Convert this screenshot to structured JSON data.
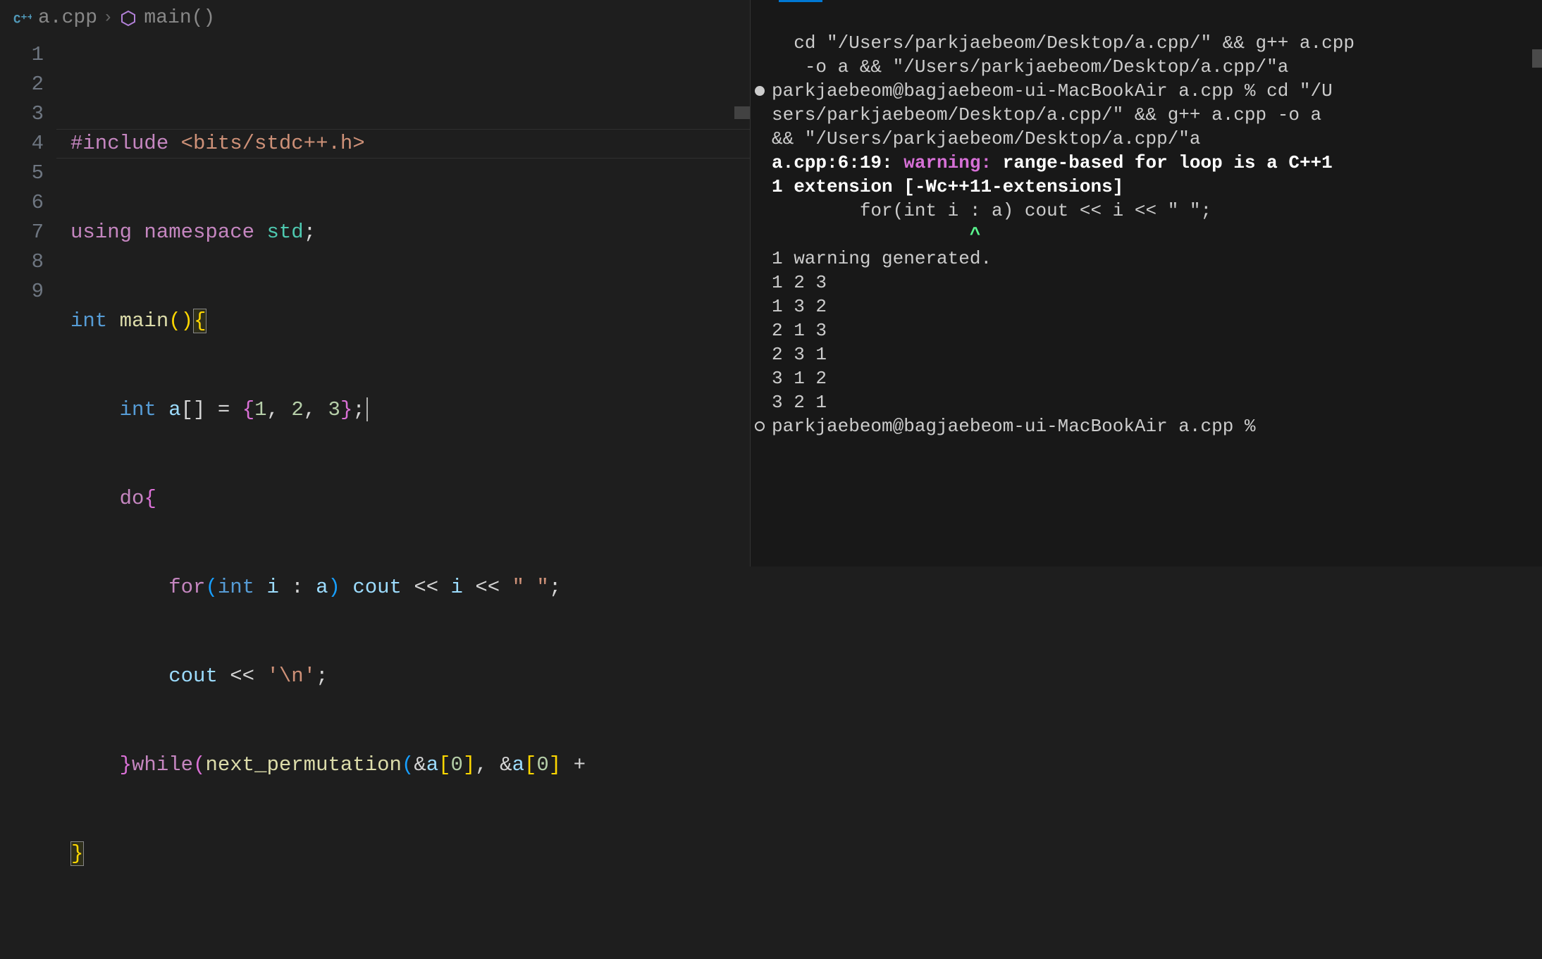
{
  "breadcrumb": {
    "file": "a.cpp",
    "symbol": "main()"
  },
  "editor": {
    "lines": [
      {
        "num": "1"
      },
      {
        "num": "2"
      },
      {
        "num": "3"
      },
      {
        "num": "4"
      },
      {
        "num": "5"
      },
      {
        "num": "6"
      },
      {
        "num": "7"
      },
      {
        "num": "8"
      },
      {
        "num": "9"
      }
    ],
    "code": {
      "l1_include": "#include",
      "l1_header": "<bits/stdc++.h>",
      "l2_using": "using",
      "l2_namespace": "namespace",
      "l2_std": "std",
      "l2_semi": ";",
      "l3_int": "int",
      "l3_main": "main",
      "l3_paren": "()",
      "l3_brace": "{",
      "l4_int": "int",
      "l4_a": "a",
      "l4_brackets": "[]",
      "l4_eq": " = ",
      "l4_braceo": "{",
      "l4_n1": "1",
      "l4_c1": ", ",
      "l4_n2": "2",
      "l4_c2": ", ",
      "l4_n3": "3",
      "l4_bracec": "}",
      "l4_semi": ";",
      "l5_do": "do",
      "l5_brace": "{",
      "l6_for": "for",
      "l6_po": "(",
      "l6_int": "int",
      "l6_i": "i",
      "l6_colon": " : ",
      "l6_a": "a",
      "l6_pc": ")",
      "l6_cout": " cout ",
      "l6_lt1": "<<",
      "l6_i2": " i ",
      "l6_lt2": "<<",
      "l6_str": " \" \"",
      "l6_semi": ";",
      "l7_cout": "cout ",
      "l7_lt": "<<",
      "l7_nl": " '\\n'",
      "l7_semi": ";",
      "l8_bracec": "}",
      "l8_while": "while",
      "l8_po": "(",
      "l8_np": "next_permutation",
      "l8_po2": "(",
      "l8_amp1": "&",
      "l8_a1": "a",
      "l8_bo1": "[",
      "l8_n0a": "0",
      "l8_bc1": "]",
      "l8_comma": ", ",
      "l8_amp2": "&",
      "l8_a2": "a",
      "l8_bo2": "[",
      "l8_n0b": "0",
      "l8_bc2": "]",
      "l8_plus": " +",
      "l9_brace": "}"
    }
  },
  "terminal": {
    "l1": "  cd \"/Users/parkjaebeom/Desktop/a.cpp/\" && g++ a.cpp",
    "l2": "   -o a && \"/Users/parkjaebeom/Desktop/a.cpp/\"a",
    "l3": "parkjaebeom@bagjaebeom-ui-MacBookAir a.cpp % cd \"/U",
    "l4": "sers/parkjaebeom/Desktop/a.cpp/\" && g++ a.cpp -o a ",
    "l5": "&& \"/Users/parkjaebeom/Desktop/a.cpp/\"a",
    "l6_loc": "a.cpp:6:19: ",
    "l6_warn": "warning: ",
    "l6_msg": "range-based for loop is a C++1",
    "l7_msg": "1 extension [-Wc++11-extensions]",
    "l8": "        for(int i : a) cout << i << \" \";",
    "l9_caret": "                  ^",
    "l10": "1 warning generated.",
    "l11": "1 2 3 ",
    "l12": "1 3 2 ",
    "l13": "2 1 3 ",
    "l14": "2 3 1 ",
    "l15": "3 1 2 ",
    "l16": "3 2 1 ",
    "l17": "parkjaebeom@bagjaebeom-ui-MacBookAir a.cpp % "
  }
}
